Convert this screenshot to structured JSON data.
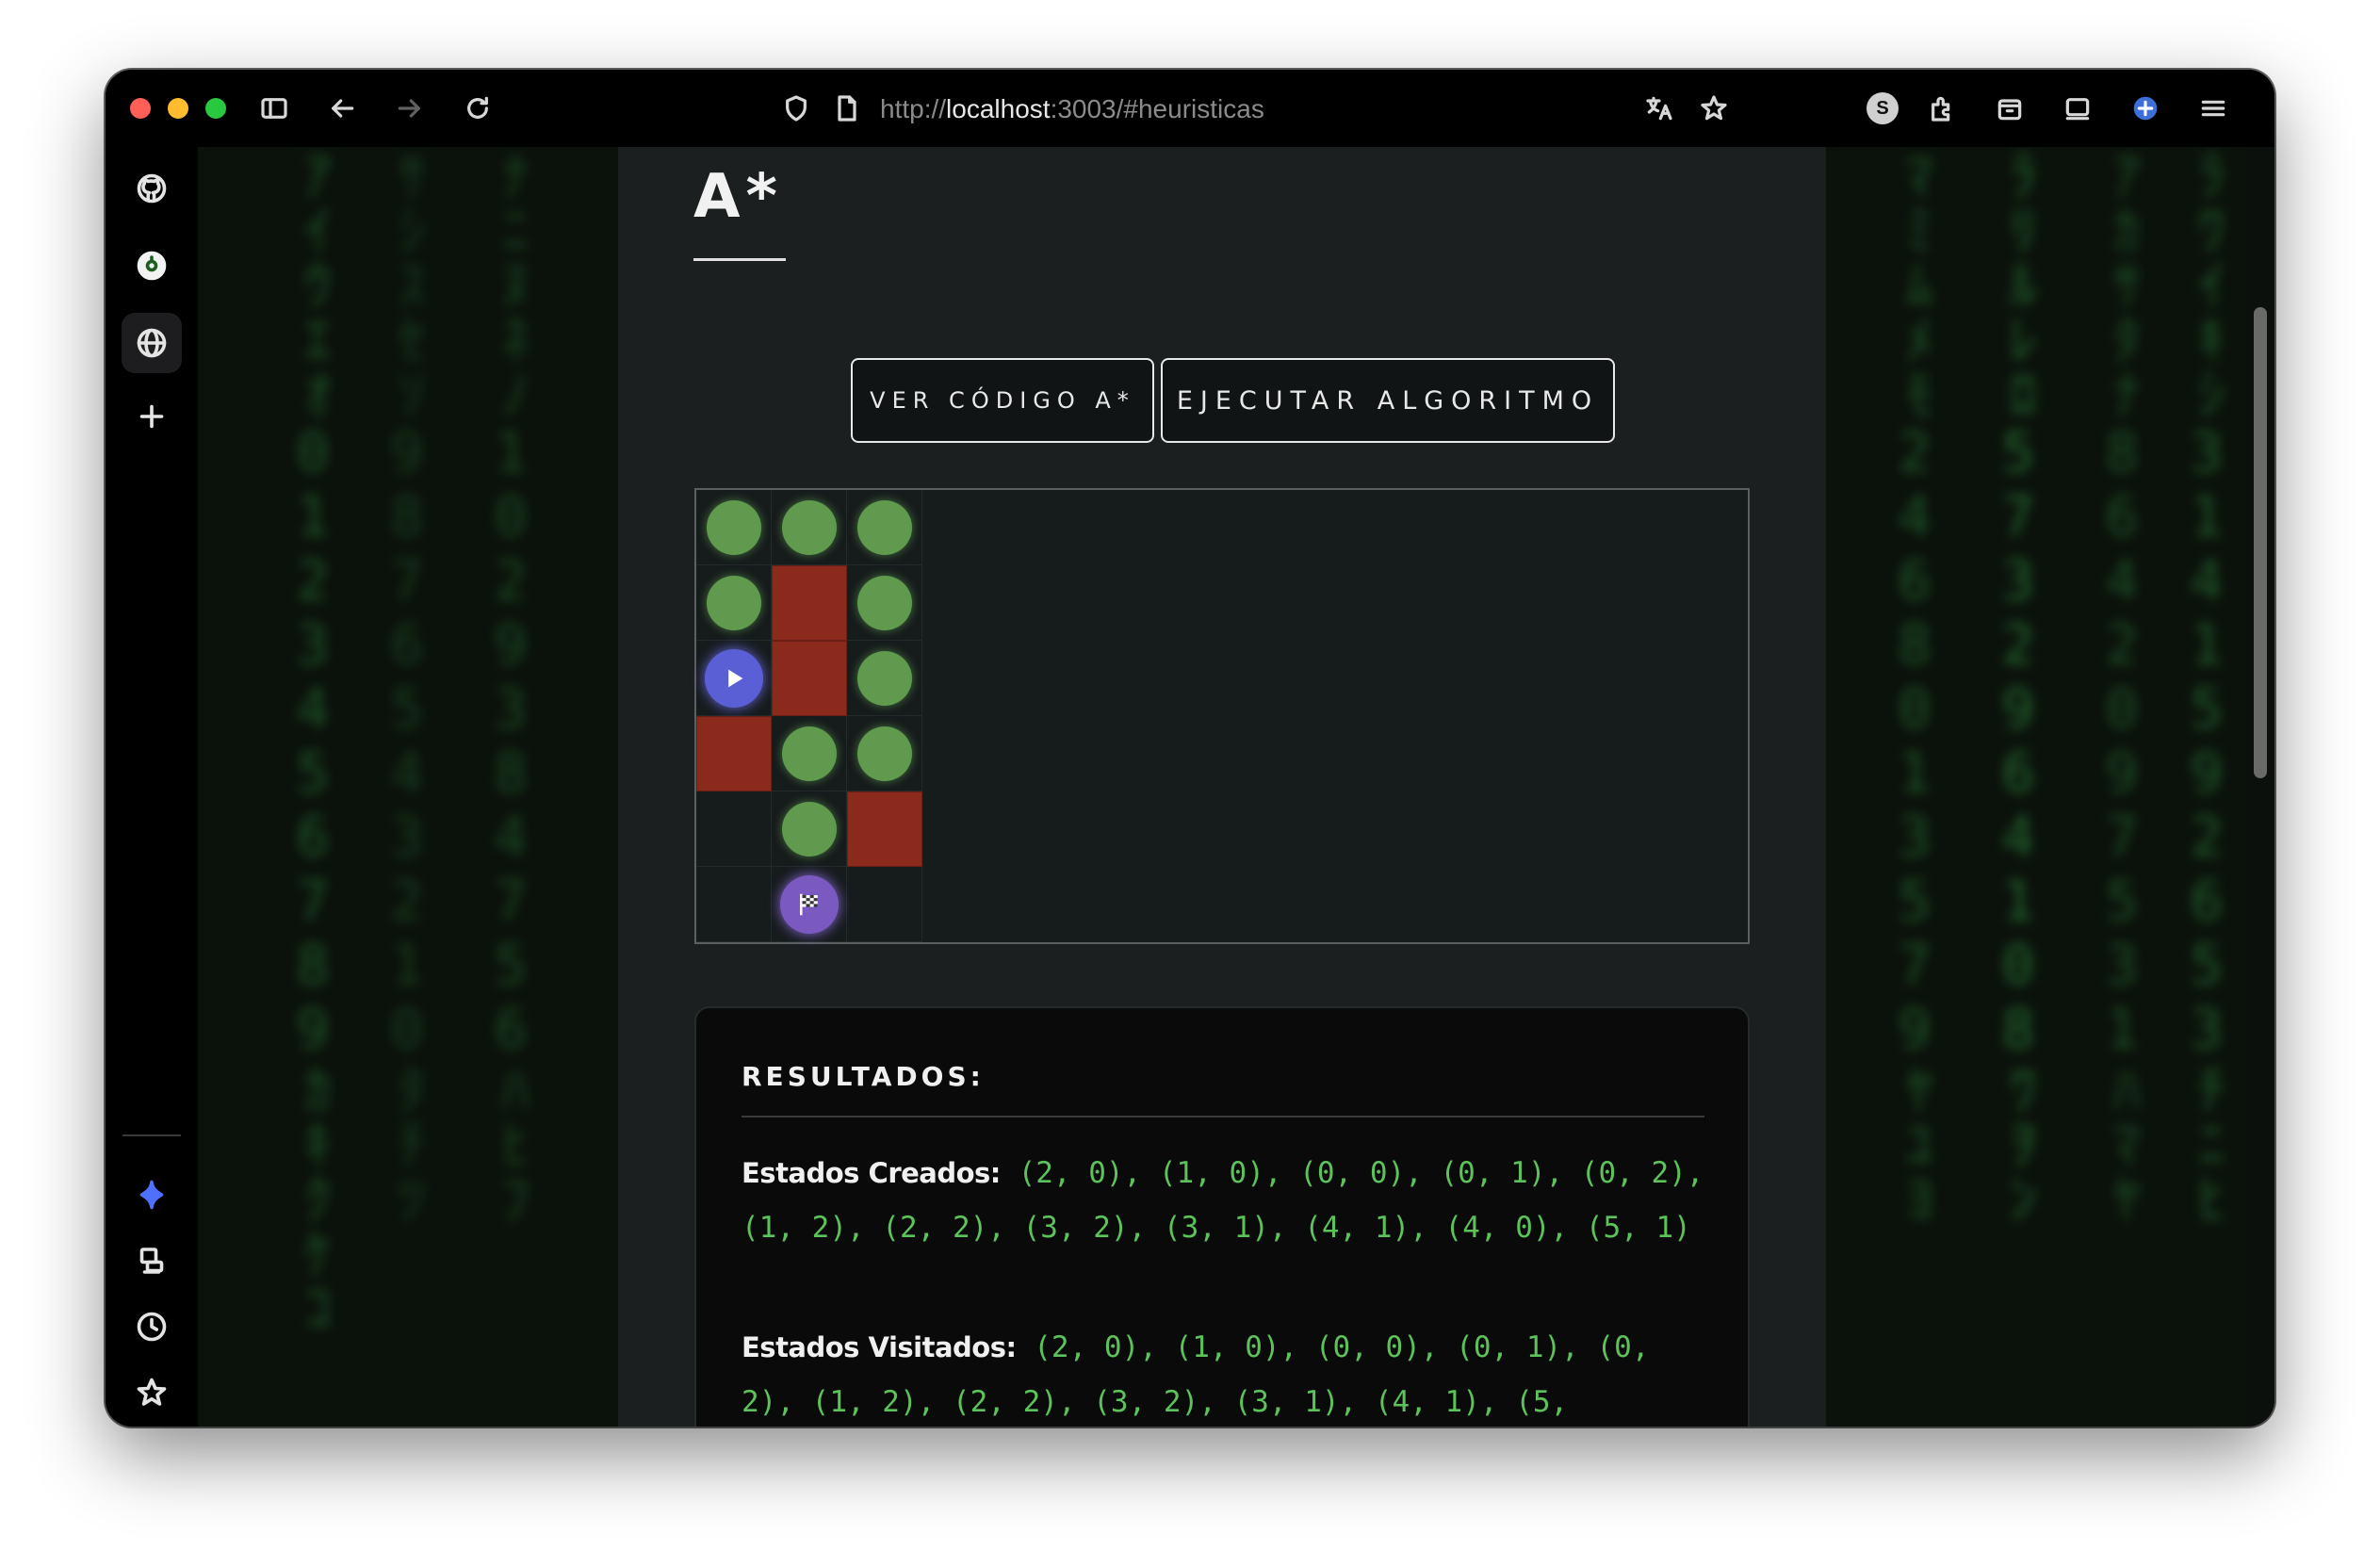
{
  "browser": {
    "url_prefix": "http://",
    "url_host": "localhost",
    "url_rest": ":3003/#heuristicas",
    "profile_initial": "S"
  },
  "sidebar": {
    "items": [
      {
        "name": "github-icon"
      },
      {
        "name": "chatgpt-icon"
      },
      {
        "name": "globe-icon"
      },
      {
        "name": "plus-icon"
      },
      {
        "name": "sparkle-icon"
      },
      {
        "name": "extensions-icon"
      },
      {
        "name": "history-icon"
      },
      {
        "name": "favorites-icon"
      },
      {
        "name": "settings-icon"
      }
    ]
  },
  "page": {
    "title": "A*",
    "buttons": {
      "view_code": "VER CÓDIGO A*",
      "run": "EJECUTAR ALGORITMO"
    },
    "grid": {
      "rows": 6,
      "cols": 3,
      "walls": [
        [
          1,
          1
        ],
        [
          2,
          1
        ],
        [
          3,
          0
        ],
        [
          4,
          2
        ]
      ],
      "path_dots": [
        [
          0,
          0
        ],
        [
          0,
          1
        ],
        [
          0,
          2
        ],
        [
          1,
          0
        ],
        [
          1,
          2
        ],
        [
          2,
          2
        ],
        [
          3,
          1
        ],
        [
          3,
          2
        ],
        [
          4,
          1
        ]
      ],
      "start": [
        2,
        0
      ],
      "goal": [
        5,
        1
      ]
    },
    "results": {
      "heading": "RESULTADOS:",
      "created_label": "Estados Creados:",
      "created_values": " (2, 0), (1, 0), (0, 0), (0, 1), (0, 2), (1, 2), (2, 2), (3, 2), (3, 1), (4, 1), (4, 0), (5, 1)",
      "visited_label": "Estados Visitados:",
      "visited_values": " (2, 0), (1, 0), (0, 0), (0, 1), (0, 2), (1, 2), (2, 2), (3, 2), (3, 1), (4, 1), (5,"
    }
  },
  "colors": {
    "accent_green": "#5cc25a",
    "wall": "#8a2a1c",
    "dot": "#5f9a4e",
    "start": "#5b5fd6",
    "goal": "#7a5ac0"
  }
}
